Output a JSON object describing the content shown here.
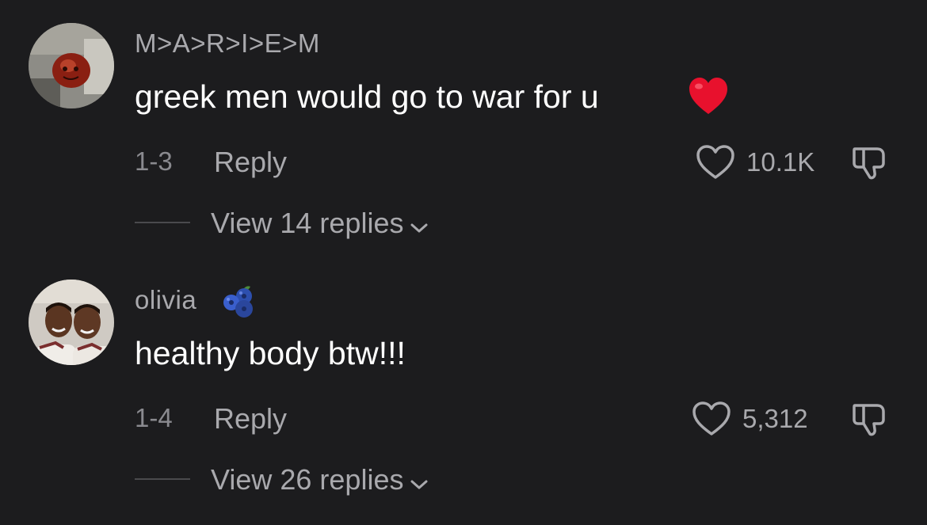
{
  "comments": [
    {
      "username": "M>A>R>I>E>M",
      "text": "greek men would go to war for u",
      "text_emoji": "red-heart",
      "date": "1-3",
      "reply_label": "Reply",
      "likes": "10.1K",
      "view_replies_label": "View 14 replies",
      "avatar": "apple-face-avatar"
    },
    {
      "username": "olivia",
      "username_emoji": "blueberries",
      "text": "healthy body btw!!!",
      "date": "1-4",
      "reply_label": "Reply",
      "likes": "5,312",
      "view_replies_label": "View 26 replies",
      "avatar": "two-people-avatar"
    }
  ],
  "colors": {
    "background": "#1c1c1e",
    "primary_text": "#ffffff",
    "secondary_text": "#a9a9ad",
    "heart_emoji": "#e8112d",
    "blueberry": "#3a5fcd"
  }
}
